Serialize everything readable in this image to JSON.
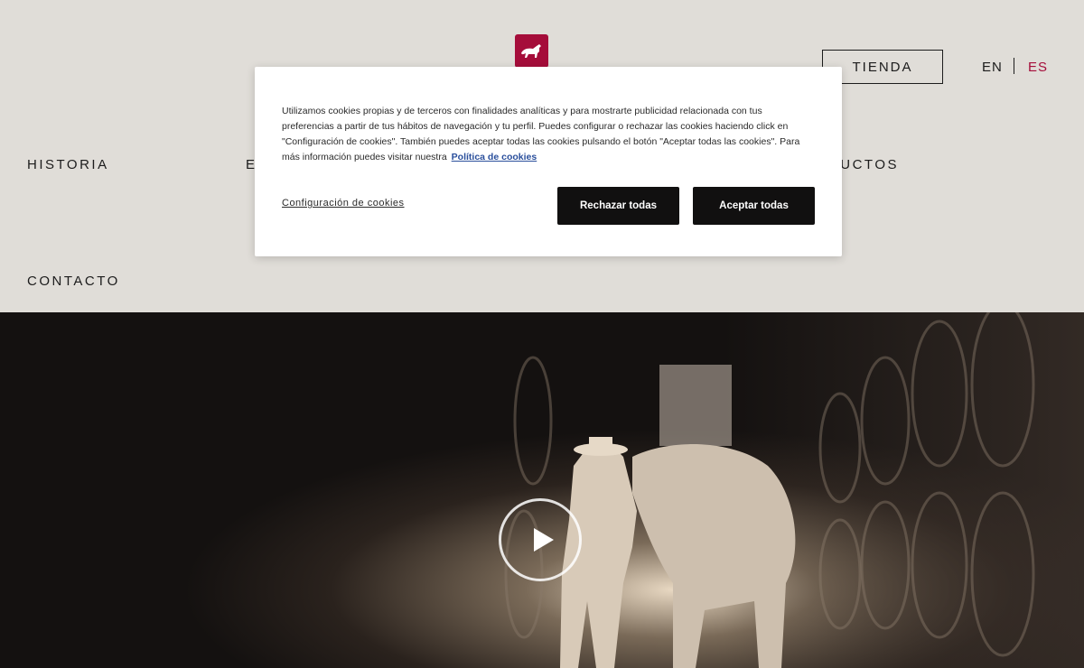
{
  "header": {
    "logo_icon": "horse-logo-icon",
    "shop_label": "TIENDA",
    "languages": [
      "EN",
      "ES"
    ],
    "active_language": "ES",
    "brand_color": "#a50d3a"
  },
  "nav": {
    "items": [
      "HISTORIA",
      "E",
      "UCTOS",
      "CONTACTO"
    ]
  },
  "hero": {
    "play_icon": "play-icon"
  },
  "cookie_banner": {
    "text": "Utilizamos cookies propias y de terceros con finalidades analíticas y para mostrarte publicidad relacionada con tus preferencias a partir de tus hábitos de navegación y tu perfil. Puedes configurar o rechazar las cookies haciendo click en \"Configuración de cookies\". También puedes aceptar todas las cookies pulsando el botón \"Aceptar todas las cookies\". Para más información puedes visitar nuestra",
    "policy_link": "Política de cookies",
    "settings_link": "Configuración de cookies",
    "reject_label": "Rechazar todas",
    "accept_label": "Aceptar todas"
  }
}
